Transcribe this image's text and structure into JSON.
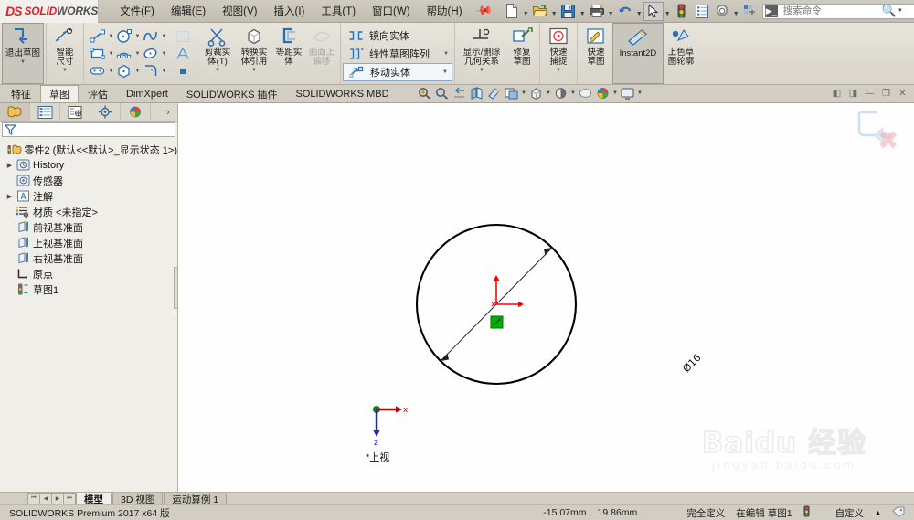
{
  "app": {
    "brand_ds": "DS",
    "brand_solid": "SOLID",
    "brand_works": "WORKS",
    "version_text": "SOLIDWORKS Premium 2017 x64 版"
  },
  "menubar": {
    "items": [
      {
        "label": "文件(F)",
        "name": "menu-file"
      },
      {
        "label": "编辑(E)",
        "name": "menu-edit"
      },
      {
        "label": "视图(V)",
        "name": "menu-view"
      },
      {
        "label": "插入(I)",
        "name": "menu-insert"
      },
      {
        "label": "工具(T)",
        "name": "menu-tools"
      },
      {
        "label": "窗口(W)",
        "name": "menu-window"
      },
      {
        "label": "帮助(H)",
        "name": "menu-help"
      }
    ],
    "pin_icon": "pushpin-icon"
  },
  "quickaccess": {
    "buttons": [
      {
        "name": "new-document-button",
        "icon": "new-document-icon",
        "has_dropdown": true
      },
      {
        "name": "open-document-button",
        "icon": "open-folder-icon",
        "has_dropdown": true
      },
      {
        "name": "save-button",
        "icon": "save-disk-icon",
        "has_dropdown": true
      },
      {
        "name": "print-button",
        "icon": "printer-icon",
        "has_dropdown": true
      },
      {
        "name": "undo-button",
        "icon": "undo-arrow-icon",
        "has_dropdown": true
      },
      {
        "name": "select-button",
        "icon": "cursor-arrow-icon",
        "has_dropdown": true,
        "selected": true
      },
      {
        "name": "rebuild-button",
        "icon": "traffic-light-icon",
        "has_dropdown": false
      },
      {
        "name": "file-properties-button",
        "icon": "properties-list-icon",
        "has_dropdown": false
      },
      {
        "name": "options-button",
        "icon": "gear-icon",
        "has_dropdown": true
      },
      {
        "name": "customize-button",
        "icon": "customize-icon",
        "has_dropdown": false
      }
    ]
  },
  "search": {
    "placeholder": "搜索命令",
    "icon": "command-search-icon",
    "magnifier": "magnifier-icon"
  },
  "window_controls": {
    "help": "?",
    "minimize": "—",
    "restore": "❐",
    "close": "✕"
  },
  "ribbon": {
    "groups": [
      {
        "name": "exit-sketch-group",
        "buttons": [
          {
            "name": "exit-sketch-button",
            "label": "退出草图",
            "icon": "exit-sketch-icon",
            "active": true,
            "dropdown": true
          }
        ]
      },
      {
        "name": "smart-dimension-group",
        "buttons": [
          {
            "name": "smart-dimension-button",
            "label": "智能尺寸",
            "icon": "smart-dimension-icon",
            "dropdown": true
          }
        ]
      },
      {
        "name": "sketch-entities-group",
        "tools": [
          {
            "name": "line-tool",
            "icon": "line-icon",
            "dropdown": true
          },
          {
            "name": "circle-tool",
            "icon": "circle-icon",
            "dropdown": true
          },
          {
            "name": "spline-tool",
            "icon": "spline-icon",
            "dropdown": true
          },
          {
            "name": "grid-tool",
            "icon": "grid-icon",
            "dropdown": false
          },
          {
            "name": "rectangle-tool",
            "icon": "rectangle-icon",
            "dropdown": true
          },
          {
            "name": "arc-tool",
            "icon": "arc-icon",
            "dropdown": true
          },
          {
            "name": "ellipse-tool",
            "icon": "ellipse-icon",
            "dropdown": true
          },
          {
            "name": "text-tool",
            "icon": "text-a-icon",
            "dropdown": false
          },
          {
            "name": "slot-tool",
            "icon": "slot-icon",
            "dropdown": true
          },
          {
            "name": "polygon-tool",
            "icon": "polygon-icon",
            "dropdown": true
          },
          {
            "name": "sketch-fillet-tool",
            "icon": "sketch-fillet-icon",
            "dropdown": true
          },
          {
            "name": "point-tool",
            "icon": "point-icon",
            "dropdown": false
          }
        ]
      },
      {
        "name": "edit-entities-group",
        "buttons": [
          {
            "name": "trim-entities-button",
            "label": "剪裁实体(T)",
            "icon": "trim-entities-icon",
            "dropdown": true
          },
          {
            "name": "convert-entities-button",
            "label": "转换实体引用",
            "icon": "convert-entities-icon",
            "dropdown": true
          },
          {
            "name": "offset-entities-button",
            "label": "等距实体",
            "icon": "offset-entities-icon",
            "dropdown": false
          },
          {
            "name": "offset-on-surface-button",
            "label": "曲面上偏移",
            "icon": "offset-on-surface-icon",
            "disabled": true,
            "dropdown": false
          }
        ]
      },
      {
        "name": "pattern-group",
        "rows": [
          {
            "name": "mirror-entities-item",
            "label": "镜向实体",
            "icon": "mirror-entities-icon",
            "dropdown": false
          },
          {
            "name": "linear-sketch-pattern-item",
            "label": "线性草图阵列",
            "icon": "linear-pattern-icon",
            "dropdown": true
          },
          {
            "name": "move-entities-item",
            "label": "移动实体",
            "icon": "move-entities-icon",
            "dropdown": true,
            "boxed": true
          }
        ]
      },
      {
        "name": "relations-group",
        "buttons": [
          {
            "name": "display-delete-relations-button",
            "label": "显示/删除几何关系",
            "icon": "display-relations-icon",
            "dropdown": true
          },
          {
            "name": "repair-sketch-button",
            "label": "修复草图",
            "icon": "repair-sketch-icon",
            "dropdown": false
          }
        ]
      },
      {
        "name": "snaps-group",
        "buttons": [
          {
            "name": "quick-snaps-button",
            "label": "快速捕捉",
            "icon": "quick-snaps-icon",
            "dropdown": true
          }
        ]
      },
      {
        "name": "tools-group",
        "buttons": [
          {
            "name": "rapid-sketch-button",
            "label": "快速草图",
            "icon": "rapid-sketch-icon",
            "dropdown": false
          },
          {
            "name": "instant2d-button",
            "label": "Instant2D",
            "icon": "instant2d-icon",
            "active": true,
            "dropdown": false
          },
          {
            "name": "shaded-sketch-contours-button",
            "label": "上色草图轮廓",
            "icon": "shaded-contours-icon",
            "dropdown": false
          }
        ]
      }
    ]
  },
  "command_tabs": {
    "tabs": [
      {
        "label": "特征",
        "name": "tab-features",
        "selected": false
      },
      {
        "label": "草图",
        "name": "tab-sketch",
        "selected": true
      },
      {
        "label": "评估",
        "name": "tab-evaluate",
        "selected": false
      },
      {
        "label": "DimXpert",
        "name": "tab-dimxpert",
        "selected": false
      },
      {
        "label": "SOLIDWORKS 插件",
        "name": "tab-solidworks-addins",
        "selected": false
      },
      {
        "label": "SOLIDWORKS MBD",
        "name": "tab-solidworks-mbd",
        "selected": false
      }
    ]
  },
  "view_toolbar": {
    "buttons": [
      {
        "name": "zoom-to-fit-button",
        "icon": "zoom-fit-icon",
        "dropdown": false
      },
      {
        "name": "zoom-to-area-button",
        "icon": "zoom-area-icon",
        "dropdown": false
      },
      {
        "name": "previous-view-button",
        "icon": "previous-view-icon",
        "dropdown": false
      },
      {
        "name": "section-view-button",
        "icon": "section-view-icon",
        "dropdown": false
      },
      {
        "name": "view-orientation-button",
        "icon": "view-orientation-icon",
        "dropdown": false
      },
      {
        "name": "display-style-button",
        "icon": "display-style-icon",
        "dropdown": true
      },
      {
        "name": "hide-show-items-button",
        "icon": "hide-show-icon",
        "dropdown": true
      },
      {
        "name": "edit-appearance-button",
        "icon": "appearance-icon",
        "dropdown": true
      },
      {
        "name": "apply-scene-button",
        "icon": "scene-icon",
        "dropdown": false
      },
      {
        "name": "view-settings-button",
        "icon": "view-settings-icon",
        "dropdown": true
      },
      {
        "name": "viewport-button",
        "icon": "viewport-icon",
        "dropdown": true
      }
    ]
  },
  "document_window_controls": {
    "prev": "◧",
    "next": "◨",
    "minimize": "—",
    "restore": "❐",
    "close": "✕"
  },
  "panel_tabs": [
    {
      "name": "featuremanager-tab",
      "icon": "featuremanager-tree-icon",
      "selected": true
    },
    {
      "name": "propertymanager-tab",
      "icon": "propertymanager-icon",
      "selected": false
    },
    {
      "name": "configurationmanager-tab",
      "icon": "configurationmanager-icon",
      "selected": false
    },
    {
      "name": "dimxpertmanager-tab",
      "icon": "dimxpert-target-icon",
      "selected": false
    },
    {
      "name": "displaymanager-tab",
      "icon": "displaymanager-sphere-icon",
      "selected": false
    }
  ],
  "filter": {
    "icon": "filter-funnel-icon",
    "value": ""
  },
  "feature_tree": {
    "root": {
      "label": "零件2  (默认<<默认>_显示状态 1>)",
      "icon": "part-document-icon",
      "name": "tree-root-part"
    },
    "items": [
      {
        "label": "History",
        "icon": "history-icon",
        "expandable": true,
        "name": "tree-item-history"
      },
      {
        "label": "传感器",
        "icon": "sensor-icon",
        "expandable": false,
        "name": "tree-item-sensors"
      },
      {
        "label": "注解",
        "icon": "annotations-icon",
        "expandable": true,
        "name": "tree-item-annotations"
      },
      {
        "label": "材质 <未指定>",
        "icon": "material-icon",
        "expandable": false,
        "name": "tree-item-material"
      },
      {
        "label": "前视基准面",
        "icon": "plane-icon",
        "expandable": false,
        "name": "tree-item-front-plane"
      },
      {
        "label": "上视基准面",
        "icon": "plane-icon",
        "expandable": false,
        "name": "tree-item-top-plane"
      },
      {
        "label": "右视基准面",
        "icon": "plane-icon",
        "expandable": false,
        "name": "tree-item-right-plane"
      },
      {
        "label": "原点",
        "icon": "origin-icon",
        "expandable": false,
        "name": "tree-item-origin"
      },
      {
        "label": "草图1",
        "icon": "sketch-icon",
        "expandable": false,
        "name": "tree-item-sketch1"
      }
    ]
  },
  "graphics": {
    "sketch": {
      "dimension_label": "Ø16",
      "dimension_name": "diameter-dimension",
      "circle_color": "#000000",
      "dimension_color": "#000000",
      "origin_color": "#ff0000",
      "selection_color": "#00b200"
    },
    "triad": {
      "x_label": "x",
      "z_label": "z",
      "x_color": "#cc0000",
      "z_color": "#2020cc",
      "view_label": "*上视"
    },
    "confirm_corner": {
      "accept_name": "exit-sketch-confirm-icon",
      "cancel_name": "cancel-sketch-icon",
      "cancel_color": "#f2a0a0"
    },
    "watermark": {
      "main_a": "Bai",
      "main_b": "du",
      "main_c": "经验",
      "sub": "jingyan.baidu.com"
    }
  },
  "document_tabs": {
    "nav": [
      "⏮",
      "◀",
      "▶",
      "⏭"
    ],
    "tabs": [
      {
        "label": "模型",
        "name": "doc-tab-model",
        "selected": true
      },
      {
        "label": "3D 视图",
        "name": "doc-tab-3dview",
        "selected": false
      },
      {
        "label": "运动算例 1",
        "name": "doc-tab-motionstudy",
        "selected": false
      }
    ]
  },
  "statusbar": {
    "version": "SOLIDWORKS Premium 2017 x64 版",
    "coord_x": "-15.07mm",
    "coord_y": "19.86mm",
    "sketch_state": "完全定义",
    "editing": "在编辑 草图1",
    "rebuild_icon": "traffic-light-icon",
    "custom": "自定义",
    "custom_caret": "▲",
    "tag_icon": "tag-icon"
  }
}
